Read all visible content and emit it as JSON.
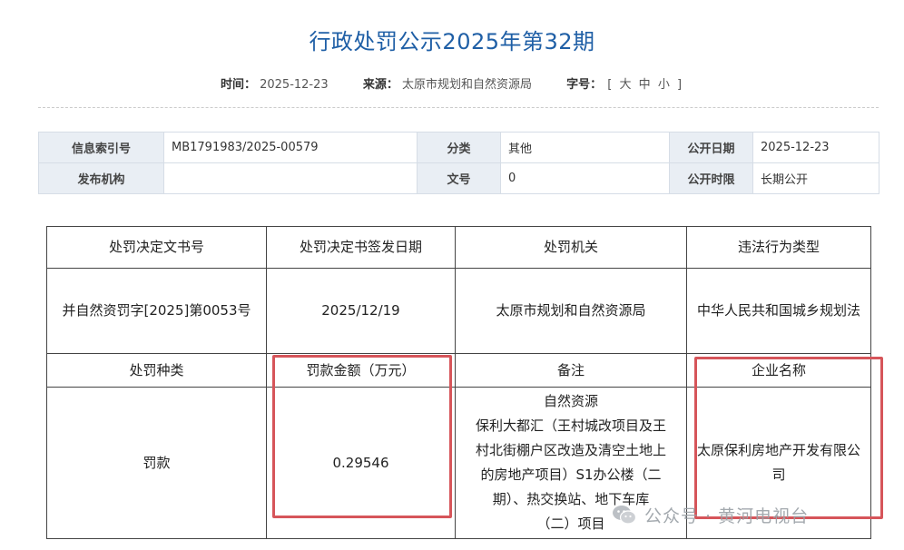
{
  "title": "行政处罚公示2025年第32期",
  "meta": {
    "time_label": "时间：",
    "time_value": "2025-12-23",
    "source_label": "来源：",
    "source_value": "太原市规划和自然资源局",
    "fontsize_label": "字号：",
    "fontsize_open": "[",
    "fontsize_options": [
      "大",
      "中",
      "小"
    ],
    "fontsize_close": "]"
  },
  "info_table": {
    "rows": [
      [
        {
          "label": "信息索引号",
          "value": "MB1791983/2025-00579"
        },
        {
          "label": "分类",
          "value": "其他"
        },
        {
          "label": "公开日期",
          "value": "2025-12-23"
        }
      ],
      [
        {
          "label": "发布机构",
          "value": ""
        },
        {
          "label": "文号",
          "value": "0"
        },
        {
          "label": "公开时限",
          "value": "长期公开"
        }
      ]
    ]
  },
  "penalty_table": {
    "headers_1": [
      "处罚决定文书号",
      "处罚决定书签发日期",
      "处罚机关",
      "违法行为类型"
    ],
    "row_1": [
      "并自然资罚字[2025]第0053号",
      "2025/12/19",
      "太原市规划和自然资源局",
      "中华人民共和国城乡规划法"
    ],
    "headers_2": [
      "处罚种类",
      "罚款金额（万元）",
      "备注",
      "企业名称"
    ],
    "row_2": {
      "type": "罚款",
      "amount": "0.29546",
      "note_lines": [
        "自然资源",
        "保利大都汇（王村城改项目及王",
        "村北街棚户区改造及清空土地上",
        "的房地产项目）S1办公楼（二",
        "期）、热交换站、地下车库",
        "（二）项目"
      ],
      "company": "太原保利房地产开发有限公司"
    }
  },
  "watermark": {
    "text": "公众号 · 黄河电视台",
    "icon": "wechat-icon"
  },
  "colors": {
    "title": "#1f5fa6",
    "label_bg": "#e9eef4",
    "highlight": "#d6555a"
  }
}
